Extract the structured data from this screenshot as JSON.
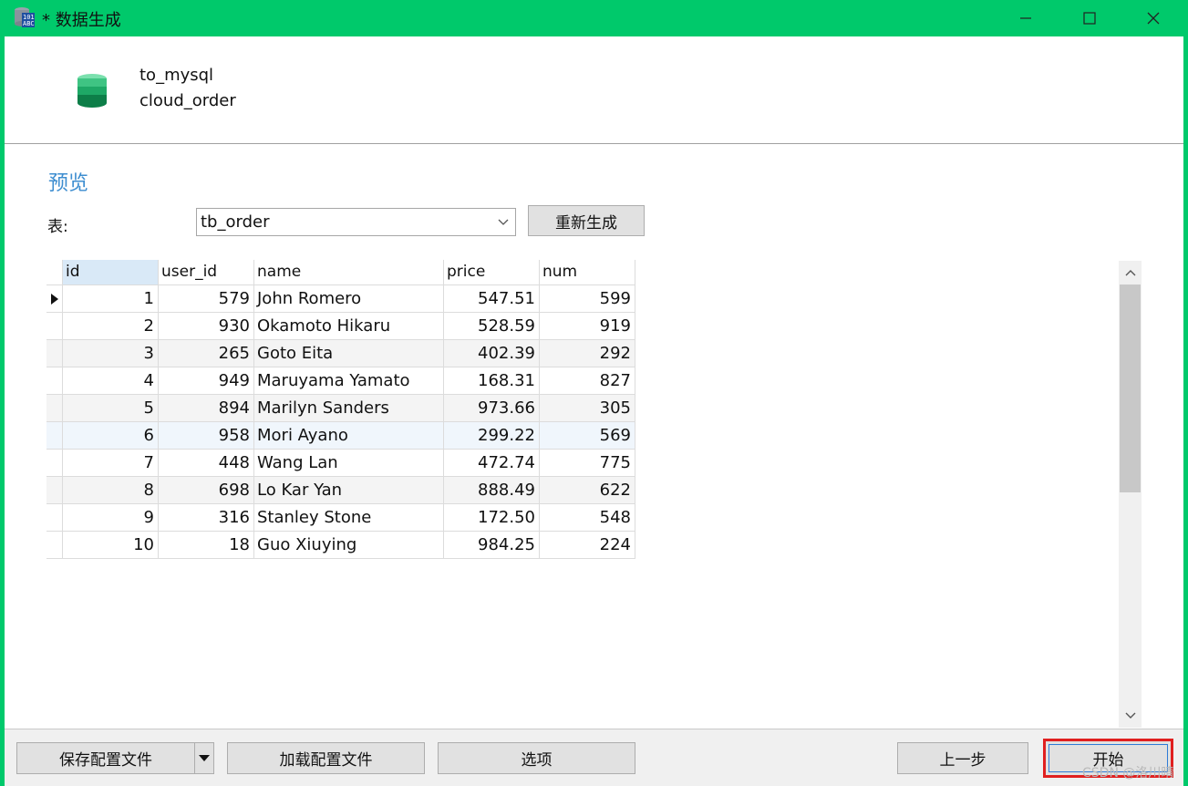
{
  "window": {
    "title": "* 数据生成",
    "title_color": "#00c96b"
  },
  "header": {
    "connection": "to_mysql",
    "database": "cloud_order"
  },
  "preview": {
    "section_title": "预览",
    "table_label": "表:",
    "selected_table": "tb_order",
    "regenerate_label": "重新生成"
  },
  "grid": {
    "columns": [
      "id",
      "user_id",
      "name",
      "price",
      "num"
    ],
    "rows": [
      {
        "id": "1",
        "user_id": "579",
        "name": "John Romero",
        "price": "547.51",
        "num": "599"
      },
      {
        "id": "2",
        "user_id": "930",
        "name": "Okamoto Hikaru",
        "price": "528.59",
        "num": "919"
      },
      {
        "id": "3",
        "user_id": "265",
        "name": "Goto Eita",
        "price": "402.39",
        "num": "292"
      },
      {
        "id": "4",
        "user_id": "949",
        "name": "Maruyama Yamato",
        "price": "168.31",
        "num": "827"
      },
      {
        "id": "5",
        "user_id": "894",
        "name": "Marilyn Sanders",
        "price": "973.66",
        "num": "305"
      },
      {
        "id": "6",
        "user_id": "958",
        "name": "Mori Ayano",
        "price": "299.22",
        "num": "569"
      },
      {
        "id": "7",
        "user_id": "448",
        "name": "Wang Lan",
        "price": "472.74",
        "num": "775"
      },
      {
        "id": "8",
        "user_id": "698",
        "name": "Lo Kar Yan",
        "price": "888.49",
        "num": "622"
      },
      {
        "id": "9",
        "user_id": "316",
        "name": "Stanley Stone",
        "price": "172.50",
        "num": "548"
      },
      {
        "id": "10",
        "user_id": "18",
        "name": "Guo Xiuying",
        "price": "984.25",
        "num": "224"
      }
    ]
  },
  "footer": {
    "save_config": "保存配置文件",
    "load_config": "加载配置文件",
    "options": "选项",
    "previous": "上一步",
    "start": "开始"
  },
  "watermark": "CSDN @洛川晴"
}
